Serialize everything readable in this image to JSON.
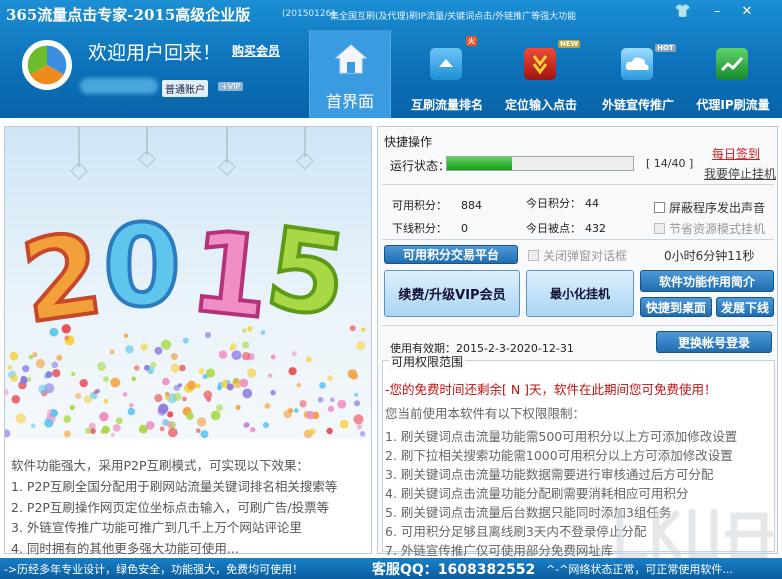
{
  "window": {
    "title": "365流量点击专家-2015高级企业版",
    "version": "(20150126)",
    "slogan": "集全国互刷(及代理)刷IP流量/关键词点击/外链推广等强大功能",
    "controls": {
      "skin": "👕",
      "minimize": "–",
      "close": "✕"
    }
  },
  "user": {
    "welcome": "欢迎用户回来！",
    "buy_member": "购买会员",
    "account_type": "普通账户",
    "vip": "+VIP"
  },
  "nav": {
    "home": "首界面",
    "items": [
      {
        "label": "互刷流量排名",
        "tag": "火",
        "icon": "arrow-up-icon",
        "color": "#2aa0e8"
      },
      {
        "label": "定位输入点击",
        "tag": "NEW",
        "icon": "arrow-down-icon",
        "color": "#d5281e"
      },
      {
        "label": "外链宣传推广",
        "tag": "HOT",
        "icon": "cloud-icon",
        "color": "#29a3e6"
      },
      {
        "label": "代理IP刷流量",
        "tag": "",
        "icon": "chart-icon",
        "color": "#2fb34a"
      }
    ]
  },
  "banner": {
    "year": "2015"
  },
  "features": {
    "intro": "软件功能强大，采用P2P互刷模式，可实现以下效果：",
    "items": [
      "1. P2P互刷全国分配用于刷网站流量关键词排名相关搜索等",
      "2. P2P互刷操作网页定位坐标点击输入，可刷广告/投票等",
      "3. 外链宣传推广功能可推广到几千上万个网站评论里",
      "4. 同时拥有的其他更多强大功能可使用..."
    ]
  },
  "quick_ops": {
    "title": "快捷操作",
    "status_label": "运行状态：",
    "progress": {
      "current": 14,
      "total": 40,
      "text": "[ 14/40 ]"
    },
    "checkin": "每日签到",
    "stop_hang": "我要停止挂机",
    "stats": {
      "available_points_label": "可用积分：",
      "available_points": "884",
      "today_points_label": "今日积分：",
      "today_points": "44",
      "offline_points_label": "下线积分：",
      "offline_points": "0",
      "today_clicked_label": "今日被点：",
      "today_clicked": "432"
    },
    "options": {
      "mute": "屏蔽程序发出声音",
      "save_resources": "节省资源模式挂机",
      "close_popup": "关闭弹窗对话框"
    },
    "buttons": {
      "trade": "可用积分交易平台",
      "renew": "续费/升级VIP会员",
      "minimize_hang": "最小化挂机",
      "intro": "软件功能作用简介",
      "shortcut": "快捷到桌面",
      "offline": "发展下线",
      "switch_account": "更换帐号登录"
    },
    "timer": "0小时6分钟11秒",
    "validity_label": "使用有效期：",
    "validity": "2015-2-3-2020-12-31"
  },
  "permissions": {
    "title": "可用权限范围",
    "free_notice": "-您的免费时间还剩余[ N ]天，软件在此期间您可免费使用！",
    "intro": "您当前使用本软件有以下权限限制：",
    "items": [
      "1. 刷关键词点击流量功能需500可用积分以上方可添加修改设置",
      "2. 刷下拉相关搜索功能需1000可用积分以上方可添加修改设置",
      "3. 刷关键词点击流量功能数据需要进行审核通过后方可分配",
      "4. 刷关键词点击流量功能分配刷需要消耗相应可用积分",
      "5. 刷关键词点击流量后台数据只能同时添加3组任务",
      "6. 可用积分足够且离线刷3天内不登录停止分配",
      "7. 外链宣传推广仅可使用部分免费网址库"
    ]
  },
  "footer": {
    "left": "->历经多年专业设计，绿色安全，功能强大，免费均可使用！",
    "qq": "客服QQ：1608382552",
    "right": "^-^网络状态正常，可正常使用软件..."
  },
  "colors": {
    "header": "#0c6fb7",
    "accent": "#1f6db0",
    "progress": "#1e9a1e",
    "notice": "#c01010"
  }
}
